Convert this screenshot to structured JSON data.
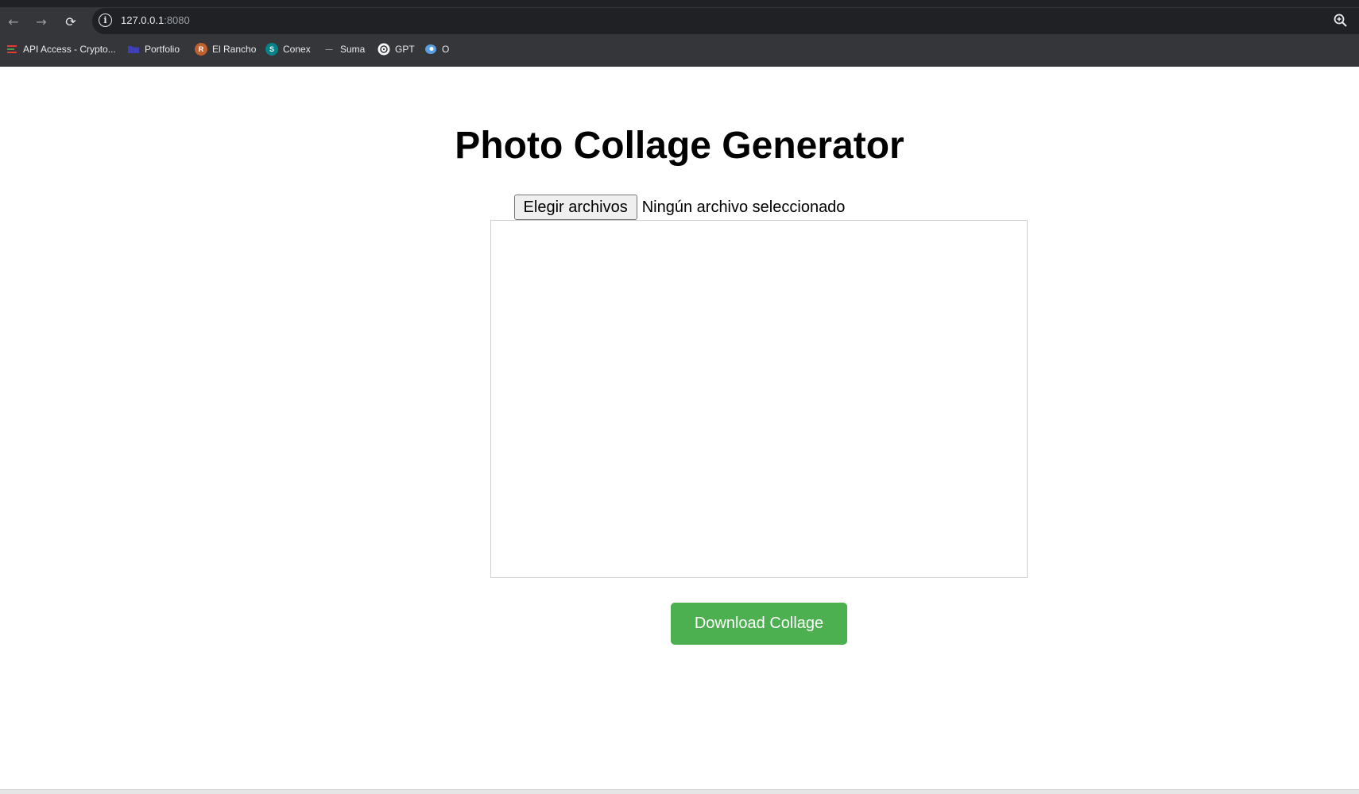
{
  "browser": {
    "url_host": "127.0.0.1",
    "url_port": ":8080",
    "nav": {
      "back": "←",
      "forward": "→",
      "reload": "⟳"
    },
    "bookmarks": [
      {
        "label": "API Access - Crypto...",
        "icon": "bar-lines-icon",
        "color": "#e53935"
      },
      {
        "label": "Portfolio",
        "icon": "folder-icon",
        "color": "#3f3fb8"
      },
      {
        "label": "El Rancho",
        "icon": "r-circle-icon",
        "color": "#c0602e"
      },
      {
        "label": "Conex",
        "icon": "sharepoint-icon",
        "color": "#038387"
      },
      {
        "label": "Suma",
        "icon": "dash-icon",
        "color": "#9aa0a6"
      },
      {
        "label": "GPT",
        "icon": "openai-icon",
        "color": "#ffffff"
      },
      {
        "label": "O",
        "icon": "chat-bubble-icon",
        "color": "#5aa0e0"
      }
    ]
  },
  "page": {
    "title": "Photo Collage Generator",
    "file_input": {
      "button_label": "Elegir archivos",
      "status": "Ningún archivo seleccionado"
    },
    "download_button": "Download Collage",
    "accent_color": "#4caf50"
  }
}
